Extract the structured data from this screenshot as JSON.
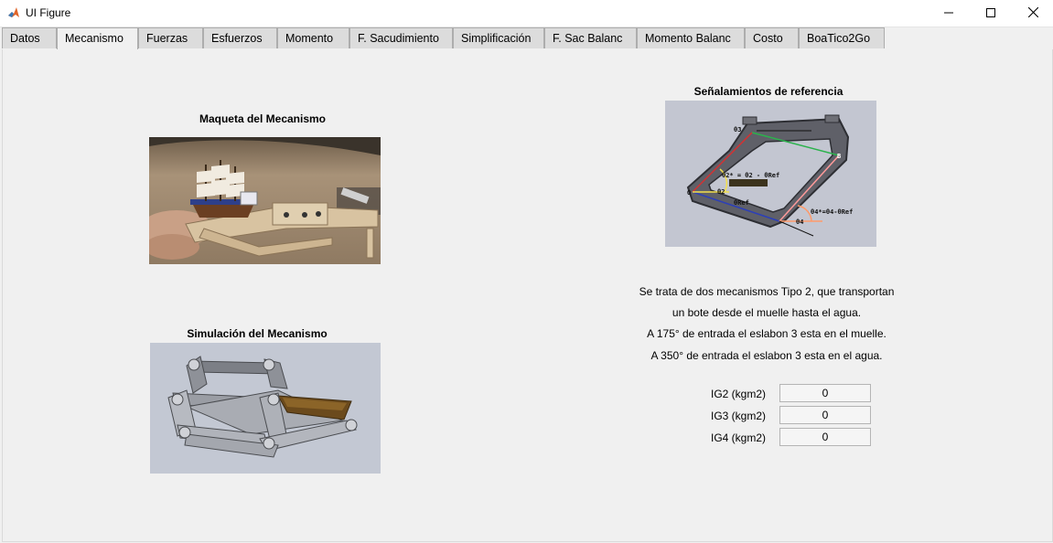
{
  "window": {
    "title": "UI Figure"
  },
  "tabs": [
    {
      "label": "Datos"
    },
    {
      "label": "Mecanismo"
    },
    {
      "label": "Fuerzas"
    },
    {
      "label": "Esfuerzos"
    },
    {
      "label": "Momento"
    },
    {
      "label": "F. Sacudimiento"
    },
    {
      "label": "Simplificación"
    },
    {
      "label": "F. Sac Balanc"
    },
    {
      "label": "Momento Balanc"
    },
    {
      "label": "Costo"
    },
    {
      "label": "BoaTico2Go"
    }
  ],
  "active_tab": "Mecanismo",
  "captions": {
    "maqueta": "Maqueta del Mecanismo",
    "simulacion": "Simulación del Mecanismo",
    "referencia": "Señalamientos de referencia"
  },
  "diagram_labels": {
    "theta3": "θ3",
    "theta2_star": "θ2* = θ2 - θRef",
    "theta2": "θ2",
    "theta_ref": "θRef",
    "theta4_star": "θ4*=θ4-θRef",
    "theta4": "θ4",
    "pt_b": "B",
    "pt_o": "O"
  },
  "description": [
    "Se trata de dos mecanismos Tipo 2, que transportan",
    "un bote desde el muelle hasta el agua.",
    "A 175° de entrada el eslabon 3 esta en el muelle.",
    "A 350° de entrada el eslabon 3 esta en el agua."
  ],
  "inertia": [
    {
      "label": "IG2 (kgm2)",
      "value": "0"
    },
    {
      "label": "IG3 (kgm2)",
      "value": "0"
    },
    {
      "label": "IG4 (kgm2)",
      "value": "0"
    }
  ],
  "icons": {
    "app": "matlab-icon",
    "minimize": "minimize-icon",
    "maximize": "maximize-icon",
    "close": "close-icon"
  },
  "colors": {
    "tab_active": "#f0f0f0",
    "tab_inactive": "#dcdcdc",
    "panel_bg": "#f0f0f0"
  }
}
